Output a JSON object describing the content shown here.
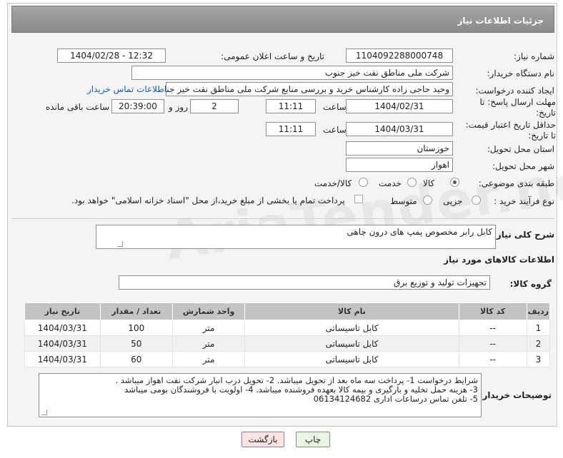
{
  "header": {
    "title": "جزئیات اطلاعات نیاز"
  },
  "form": {
    "need_number_label": "شماره نیاز:",
    "need_number": "1104092288000748",
    "announce_label": "تاریخ و ساعت اعلان عمومی:",
    "announce_value": "1404/02/28 - 12:32",
    "buyer_org_label": "نام دستگاه خریدار:",
    "buyer_org": "شرکت ملی مناطق نفت خیز جنوب",
    "creator_label": "ایجاد کننده درخواست:",
    "creator": "وحید حاجی زاده  کارشناس خرید و بررسی منابع  شرکت ملی مناطق نفت خیز جنوب",
    "contact_link": "اطلاعات تماس خریدار",
    "send_deadline_label": "مهلت ارسال پاسخ: تا تاریخ:",
    "send_date": "1404/02/31",
    "time_label": "ساعت",
    "send_time": "11:11",
    "days_value": "2",
    "days_label": "روز و",
    "remaining_time": "20:39:00",
    "remaining_label": "ساعت باقی مانده",
    "price_validity_label": "حداقل تاریخ اعتبار قیمت: تا تاریخ:",
    "price_date": "1404/03/31",
    "price_time": "11:11",
    "province_label": "استان محل تحویل:",
    "province": "خوزستان",
    "city_label": "شهر محل تحویل:",
    "city": "اهواز",
    "category_label": "طبقه بندی موضوعی:",
    "category_options": [
      "کالا",
      "خدمت",
      "کالا/خدمت"
    ],
    "process_label": "نوع فرآیند خرید :",
    "process_options": [
      "جزیی",
      "متوسط"
    ],
    "payment_note": "پرداخت تمام یا بخشی از مبلغ خرید،از محل \"اسناد خزانه اسلامی\" خواهد بود."
  },
  "description": {
    "label": "شرح کلی نیاز:",
    "value": "کابل رابر مخصوص پمپ های درون چاهی"
  },
  "goods": {
    "section_title": "اطلاعات کالاهای مورد نیاز",
    "group_label": "گروه کالا:",
    "group_value": "تجهیزات تولید و توزیع برق",
    "columns": [
      "ردیف",
      "کد کالا",
      "نام کالا",
      "واحد شمارش",
      "تعداد / مقدار",
      "تاریخ نیاز"
    ],
    "rows": [
      {
        "idx": "1",
        "code": "--",
        "name": "کابل تاسیساتی",
        "unit": "متر",
        "qty": "100",
        "date": "1404/03/31"
      },
      {
        "idx": "2",
        "code": "--",
        "name": "کابل تاسیساتی",
        "unit": "متر",
        "qty": "50",
        "date": "1404/03/31"
      },
      {
        "idx": "3",
        "code": "--",
        "name": "کابل تاسیساتی",
        "unit": "متر",
        "qty": "60",
        "date": "1404/03/31"
      }
    ]
  },
  "notes": {
    "label": "توضیحات خریدار:",
    "lines": [
      "شرایط درخواست 1-     پرداخت سه ماه بعد از تحویل میباشد. 2-    تحویل درب انبار شرکت نفت اهواز میباشد .",
      "3-    هزینه حمل تخلیه و بارگیری و بیمه کالا بعهده فروشنده میباشد. 4-       اولویت با فروشندگان بومی میباشد",
      "5-    تلفن تماس درساعات اداری 06134124682"
    ]
  },
  "buttons": {
    "print": "چاپ",
    "back": "بازگشت"
  },
  "watermark": "AriaTender.neT"
}
